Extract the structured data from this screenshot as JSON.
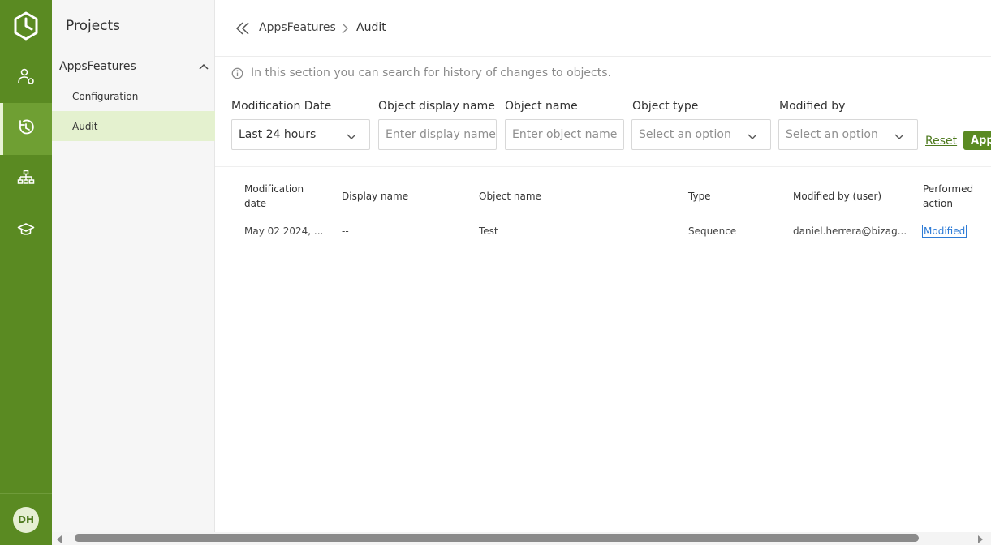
{
  "rail": {
    "items": [
      {
        "icon": "user-settings-icon"
      },
      {
        "icon": "audit-history-icon"
      },
      {
        "icon": "hierarchy-icon"
      },
      {
        "icon": "graduation-cap-icon"
      }
    ],
    "avatar_initials": "DH",
    "accent": "#5a8a22"
  },
  "sidebar": {
    "title": "Projects",
    "group_label": "AppsFeatures",
    "items": [
      {
        "label": "Configuration"
      },
      {
        "label": "Audit"
      }
    ]
  },
  "breadcrumb": {
    "parent": "AppsFeatures",
    "current": "Audit"
  },
  "info_text": "In this section you can search for history of changes to objects.",
  "filters": {
    "modification_date": {
      "label": "Modification Date",
      "value": "Last 24 hours"
    },
    "object_display_name": {
      "label": "Object display name",
      "placeholder": "Enter display name"
    },
    "object_name": {
      "label": "Object name",
      "placeholder": "Enter object name"
    },
    "object_type": {
      "label": "Object type",
      "placeholder": "Select an option"
    },
    "modified_by": {
      "label": "Modified by",
      "placeholder": "Select an option"
    },
    "reset_label": "Reset",
    "apply_label": "Apply"
  },
  "table": {
    "columns": [
      "Modification date",
      "Display name",
      "Object name",
      "Type",
      "Modified by (user)",
      "Performed action"
    ],
    "rows": [
      {
        "modification_date": "May 02 2024, ...",
        "display_name": "--",
        "object_name": "Test",
        "type": "Sequence",
        "modified_by": "daniel.herrera@bizag...",
        "performed_action": "Modified"
      }
    ]
  }
}
